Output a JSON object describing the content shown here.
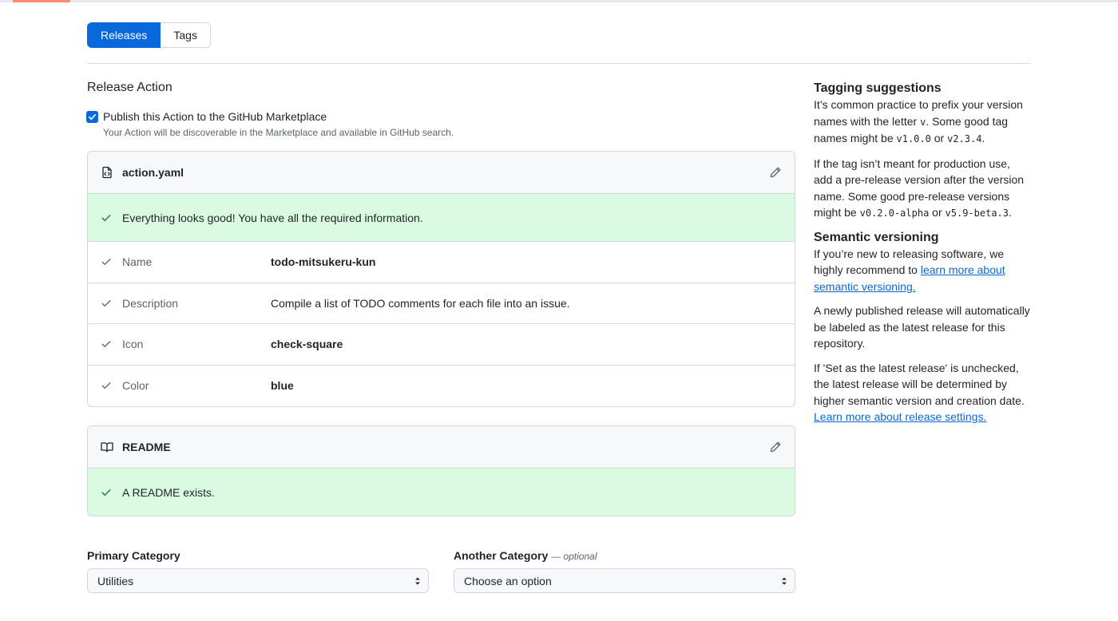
{
  "tabs": [
    {
      "label": "Releases",
      "active": true
    },
    {
      "label": "Tags",
      "active": false
    }
  ],
  "release_action": {
    "title": "Release Action",
    "publish": {
      "checked": true,
      "label": "Publish this Action to the GitHub Marketplace",
      "note": "Your Action will be discoverable in the Marketplace and available in GitHub search."
    },
    "action_file": {
      "title": "action.yaml",
      "success": "Everything looks good! You have all the required information.",
      "rows": [
        {
          "key": "Name",
          "value": "todo-mitsukeru-kun"
        },
        {
          "key": "Description",
          "value": "Compile a list of TODO comments for each file into an issue."
        },
        {
          "key": "Icon",
          "value": "check-square"
        },
        {
          "key": "Color",
          "value": "blue"
        }
      ]
    },
    "readme": {
      "title": "README",
      "success": "A README exists."
    }
  },
  "categories": {
    "primary_label": "Primary Category",
    "primary_value": "Utilities",
    "another_label": "Another Category",
    "another_optional": "— optional",
    "another_value": "Choose an option"
  },
  "sidebar": {
    "tagging_title": "Tagging suggestions",
    "tagging_p1": {
      "a": "It’s common practice to prefix your version names with the letter ",
      "code1": "v",
      "b": ". Some good tag names might be ",
      "code2": "v1.0.0",
      "c": " or ",
      "code3": "v2.3.4",
      "d": "."
    },
    "tagging_p2": {
      "a": "If the tag isn’t meant for production use, add a pre-release version after the version name. Some good pre-release versions might be ",
      "code1": "v0.2.0-alpha",
      "b": " or ",
      "code2": "v5.9-beta.3",
      "c": "."
    },
    "semver_title": "Semantic versioning",
    "semver_p1": {
      "a": "If you’re new to releasing software, we highly recommend to ",
      "link": "learn more about semantic versioning."
    },
    "semver_p2": "A newly published release will automatically be labeled as the latest release for this repository.",
    "semver_p3": {
      "a": "If 'Set as the latest release' is unchecked, the latest release will be determined by higher semantic version and creation date. ",
      "link": "Learn more about release settings."
    }
  },
  "colors": {
    "accent": "#0969da",
    "success_bg": "#dafbe1",
    "success_icon": "#1a7f37",
    "border": "#d0d7de"
  }
}
